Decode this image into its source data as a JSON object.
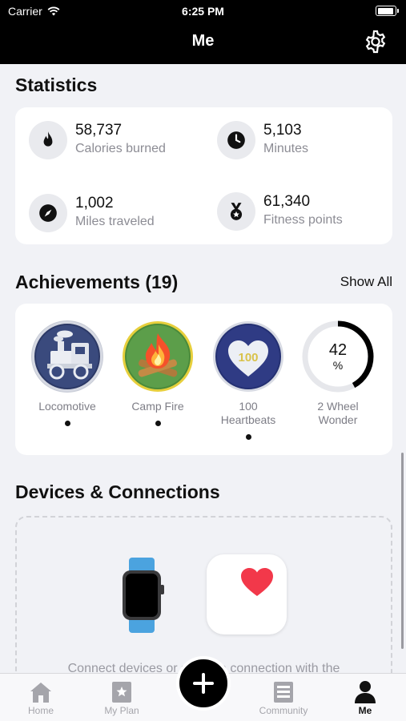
{
  "status": {
    "carrier": "Carrier",
    "time": "6:25 PM"
  },
  "nav": {
    "title": "Me"
  },
  "statistics": {
    "title": "Statistics",
    "items": [
      {
        "value": "58,737",
        "label": "Calories burned",
        "icon": "flame-icon"
      },
      {
        "value": "5,103",
        "label": "Minutes",
        "icon": "clock-icon"
      },
      {
        "value": "1,002",
        "label": "Miles traveled",
        "icon": "compass-icon"
      },
      {
        "value": "61,340",
        "label": "Fitness points",
        "icon": "medal-icon"
      }
    ]
  },
  "achievements": {
    "title": "Achievements (19)",
    "show_all": "Show All",
    "items": [
      {
        "name": "Locomotive",
        "icon": "locomotive-badge"
      },
      {
        "name": "Camp Fire",
        "icon": "campfire-badge"
      },
      {
        "name": "100 Heartbeats",
        "icon": "heart-badge",
        "badge_text": "100"
      },
      {
        "name": "2 Wheel Wonder",
        "progress_text": "42",
        "progress_unit": "%",
        "progress": 0.42
      }
    ]
  },
  "devices": {
    "title": "Devices & Connections",
    "text": "Connect devices or set up a connection with the"
  },
  "tabs": [
    {
      "label": "Home",
      "icon": "home-icon"
    },
    {
      "label": "My Plan",
      "icon": "plan-icon"
    },
    {
      "label": "",
      "icon": "plus-icon"
    },
    {
      "label": "Community",
      "icon": "community-icon"
    },
    {
      "label": "Me",
      "icon": "person-icon"
    }
  ],
  "colors": {
    "accent": "#000000",
    "background": "#f1f2f6",
    "heart": "#f2384a",
    "watch_band": "#4ba3df"
  }
}
